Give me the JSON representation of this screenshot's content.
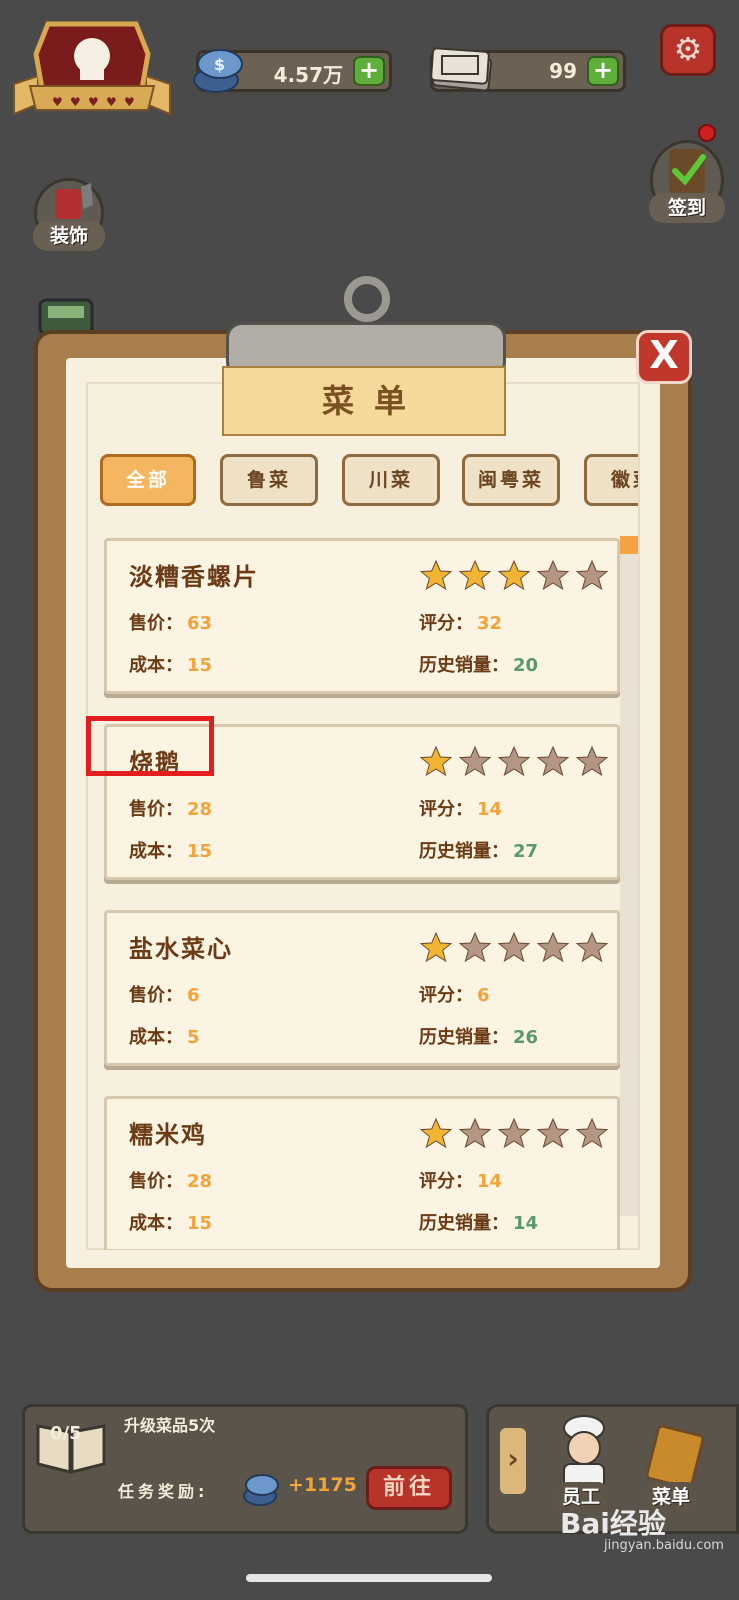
{
  "hud": {
    "coins": "4.57万",
    "tickets": "99",
    "plus_label": "+"
  },
  "side": {
    "decorate": "装饰",
    "sign_in": "签到"
  },
  "menu": {
    "title": "菜单",
    "close_label": "X",
    "tabs": [
      {
        "label": "全部",
        "active": true
      },
      {
        "label": "鲁菜",
        "active": false
      },
      {
        "label": "川菜",
        "active": false
      },
      {
        "label": "闽粤菜",
        "active": false
      },
      {
        "label": "徽菜",
        "active": false
      }
    ],
    "labels": {
      "price": "售价：",
      "cost": "成本：",
      "score": "评分：",
      "sales": "历史销量："
    },
    "dishes": [
      {
        "name": "淡糟香螺片",
        "stars": 3,
        "price": "63",
        "cost": "15",
        "score": "32",
        "sales": "20"
      },
      {
        "name": "烧鹅",
        "stars": 1,
        "price": "28",
        "cost": "15",
        "score": "14",
        "sales": "27"
      },
      {
        "name": "盐水菜心",
        "stars": 1,
        "price": "6",
        "cost": "5",
        "score": "6",
        "sales": "26"
      },
      {
        "name": "糯米鸡",
        "stars": 1,
        "price": "28",
        "cost": "15",
        "score": "14",
        "sales": "14"
      }
    ],
    "star_max": 5,
    "star_on_color": "#f2b533",
    "star_off_color": "#b39684"
  },
  "task": {
    "progress": "0/5",
    "title": "升级菜品5次",
    "reward_label": "任务奖励:",
    "reward_value": "+1175",
    "go_label": "前往"
  },
  "bottom": {
    "staff": "员工",
    "menu": "菜单"
  },
  "watermark": {
    "brand": "Bai经验",
    "site": "jingyan.baidu.com"
  }
}
